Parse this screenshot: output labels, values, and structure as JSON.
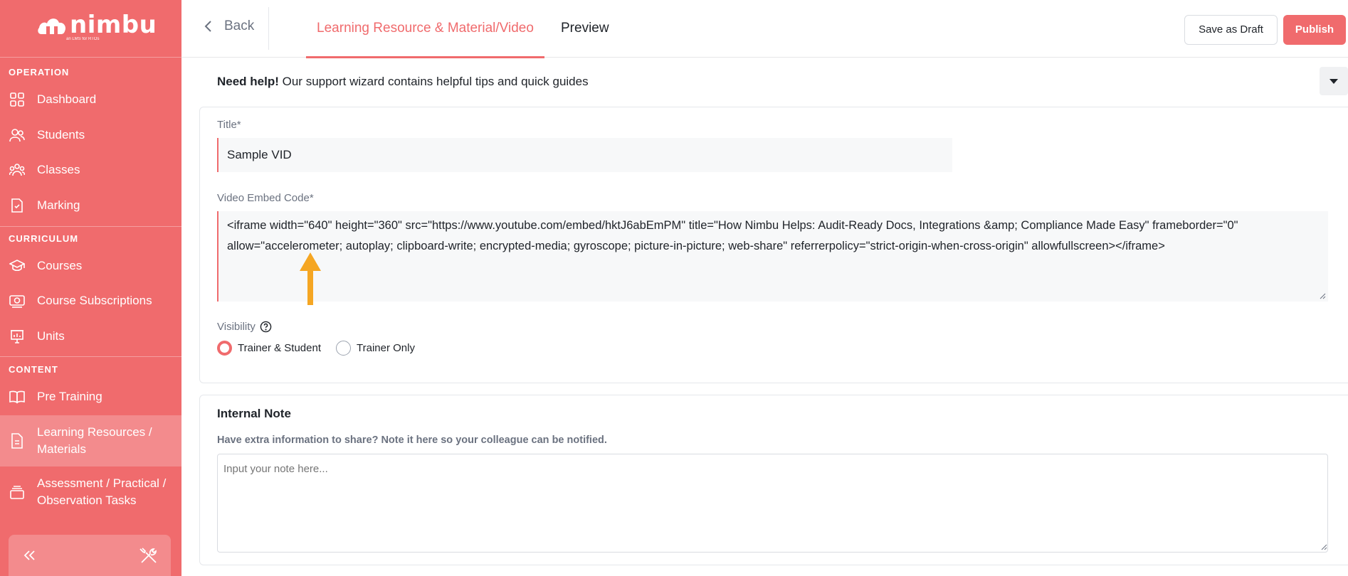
{
  "brand": {
    "name": "nimbu",
    "tagline": "an LMS for RTOs",
    "accent_color": "#f06b6d"
  },
  "sidebar": {
    "sections": [
      {
        "label": "OPERATION"
      },
      {
        "label": "CURRICULUM"
      },
      {
        "label": "CONTENT"
      }
    ],
    "items": [
      {
        "label": "Dashboard",
        "icon": "grid-icon"
      },
      {
        "label": "Students",
        "icon": "users-icon"
      },
      {
        "label": "Classes",
        "icon": "group-icon"
      },
      {
        "label": "Marking",
        "icon": "checklist-icon"
      },
      {
        "label": "Courses",
        "icon": "graduation-cap-icon"
      },
      {
        "label": "Course Subscriptions",
        "icon": "subscription-icon"
      },
      {
        "label": "Units",
        "icon": "presentation-icon"
      },
      {
        "label": "Pre Training",
        "icon": "book-icon"
      },
      {
        "label": "Learning Resources / Materials",
        "icon": "document-icon",
        "active": true
      },
      {
        "label": "Assessment / Practical / Observation Tasks",
        "icon": "stack-icon"
      }
    ],
    "collapse_icon": "double-chevron-left-icon",
    "tools_icon": "tools-icon"
  },
  "topbar": {
    "back_label": "Back",
    "tabs": [
      {
        "label": "Learning Resource & Material/Video",
        "active": true
      },
      {
        "label": "Preview",
        "active": false
      }
    ],
    "save_draft_label": "Save as Draft",
    "publish_label": "Publish"
  },
  "help": {
    "strong": "Need help!",
    "text": " Our support wizard contains helpful tips and quick guides"
  },
  "form": {
    "title_label": "Title*",
    "title_value": "Sample VID",
    "embed_label": "Video Embed Code*",
    "embed_value": "<iframe width=\"640\" height=\"360\" src=\"https://www.youtube.com/embed/hktJ6abEmPM\" title=\"How Nimbu Helps: Audit-Ready Docs, Integrations &amp; Compliance Made Easy\" frameborder=\"0\" allow=\"accelerometer; autoplay; clipboard-write; encrypted-media; gyroscope; picture-in-picture; web-share\" referrerpolicy=\"strict-origin-when-cross-origin\" allowfullscreen></iframe>",
    "visibility_label": "Visibility",
    "visibility_options": [
      {
        "label": "Trainer & Student",
        "checked": true
      },
      {
        "label": "Trainer Only",
        "checked": false
      }
    ]
  },
  "note": {
    "title": "Internal Note",
    "subtitle": "Have extra information to share? Note it here so your colleague can be notified.",
    "placeholder": "Input your note here..."
  },
  "annotation": {
    "arrow_color": "#f5a623"
  }
}
